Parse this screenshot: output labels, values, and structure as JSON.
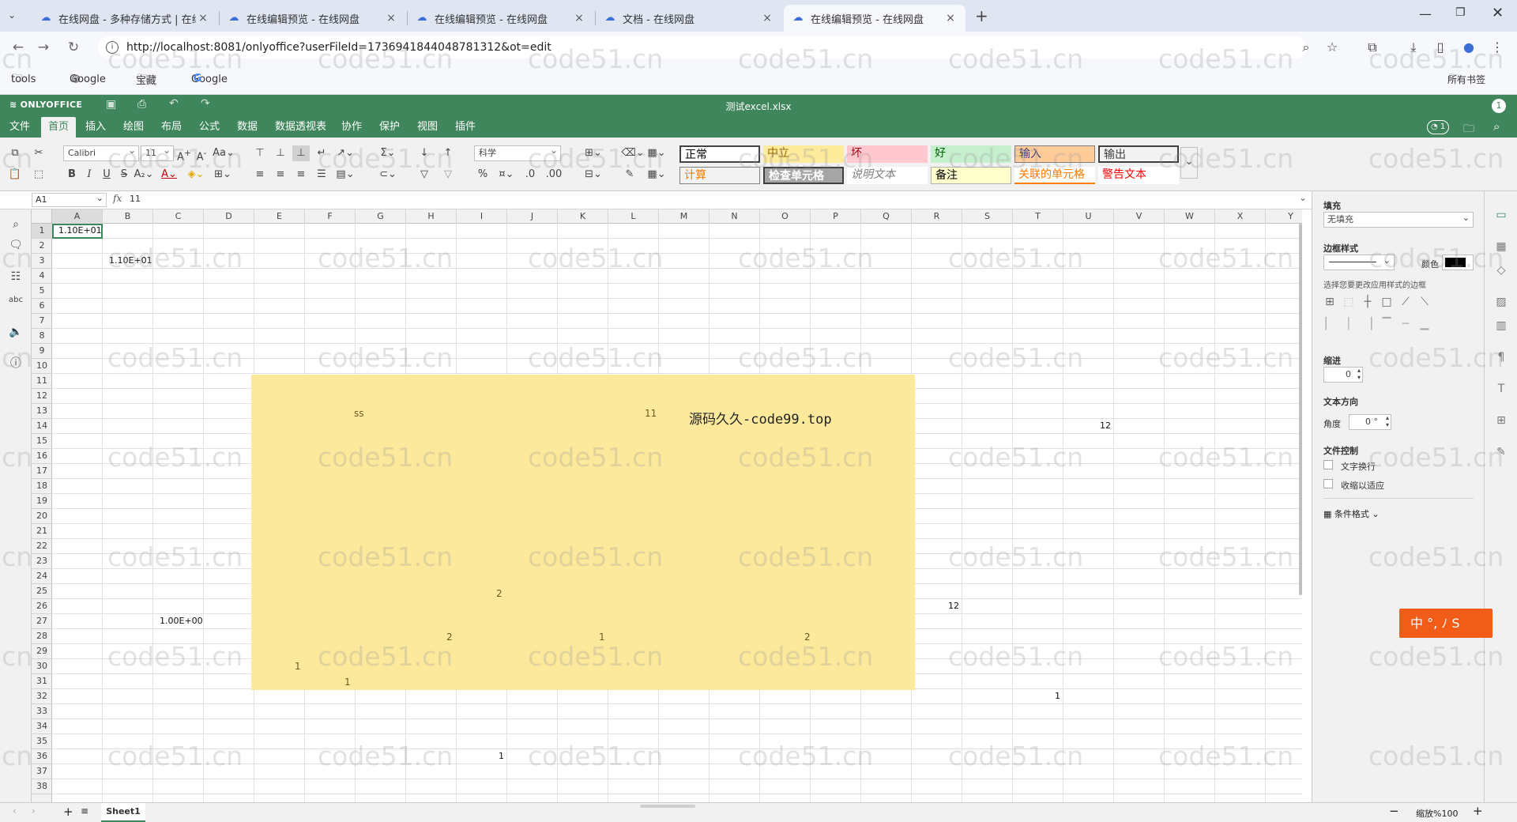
{
  "browser": {
    "tabs": [
      {
        "label": "在线网盘 - 多种存储方式 | 在线",
        "active": false
      },
      {
        "label": "在线编辑预览 - 在线网盘",
        "active": false
      },
      {
        "label": "在线编辑预览 - 在线网盘",
        "active": false
      },
      {
        "label": "文档 - 在线网盘",
        "active": false
      },
      {
        "label": "在线编辑预览 - 在线网盘",
        "active": true
      }
    ],
    "url": "http://localhost:8081/onlyoffice?userFileId=1736941844048781312&ot=edit",
    "bookmarks": [
      "tools",
      "Google",
      "宝藏",
      "Google"
    ],
    "all_bookmarks": "所有书签"
  },
  "editor": {
    "brand": "ONLYOFFICE",
    "filename": "测试excel.xlsx",
    "user_initial": "1",
    "menu": [
      "文件",
      "首页",
      "插入",
      "绘图",
      "布局",
      "公式",
      "数据",
      "数据透视表",
      "协作",
      "保护",
      "视图",
      "插件"
    ],
    "active_menu": "首页",
    "collab_count": "1"
  },
  "toolbar": {
    "font_name": "Calibri",
    "font_size": "11",
    "number_format": "科学",
    "cell_styles": [
      {
        "label": "正常",
        "bg": "#ffffff",
        "color": "#000000"
      },
      {
        "label": "中立",
        "bg": "#ffeb9c",
        "color": "#9c6500"
      },
      {
        "label": "坏",
        "bg": "#ffc7ce",
        "color": "#9c0006"
      },
      {
        "label": "好",
        "bg": "#c6efce",
        "color": "#006100"
      },
      {
        "label": "输入",
        "bg": "#ffcc99",
        "color": "#3f3f76"
      },
      {
        "label": "输出",
        "bg": "#f2f2f2",
        "color": "#3f3f3f"
      },
      {
        "label": "计算",
        "bg": "#f2f2f2",
        "color": "#fa7d00"
      },
      {
        "label": "检查单元格",
        "bg": "#a5a5a5",
        "color": "#ffffff"
      },
      {
        "label": "说明文本",
        "bg": "#ffffff",
        "color": "#7f7f7f"
      },
      {
        "label": "备注",
        "bg": "#ffffcc",
        "color": "#000000"
      },
      {
        "label": "关联的单元格",
        "bg": "#ffffff",
        "color": "#fa7d00"
      },
      {
        "label": "警告文本",
        "bg": "#ffffff",
        "color": "#ff0000"
      }
    ]
  },
  "formula_bar": {
    "cell_ref": "A1",
    "fx": "fx",
    "value": "11"
  },
  "sheet": {
    "columns": [
      "A",
      "B",
      "C",
      "D",
      "E",
      "F",
      "G",
      "H",
      "I",
      "J",
      "K",
      "L",
      "M",
      "N",
      "O",
      "P",
      "Q",
      "R",
      "S",
      "T",
      "U",
      "V",
      "W",
      "X",
      "Y"
    ],
    "rows": [
      "1",
      "2",
      "3",
      "4",
      "5",
      "6",
      "7",
      "8",
      "9",
      "10",
      "11",
      "12",
      "13",
      "14",
      "15",
      "16",
      "17",
      "18",
      "19",
      "20",
      "21",
      "22",
      "23",
      "24",
      "25",
      "26",
      "27",
      "28",
      "29",
      "30",
      "31",
      "32",
      "33",
      "34",
      "35",
      "36",
      "37",
      "38"
    ],
    "cells": [
      {
        "ref": "A1",
        "text": "1.10E+01"
      },
      {
        "ref": "B3",
        "text": "1.10E+01"
      },
      {
        "ref": "C27",
        "text": "1.00E+00"
      },
      {
        "ref": "U14",
        "text": "12"
      },
      {
        "ref": "R26",
        "text": "12"
      },
      {
        "ref": "T32",
        "text": "1"
      },
      {
        "ref": "I36",
        "text": "1"
      }
    ],
    "shape": {
      "title": "源码久久-code99.top",
      "labels": [
        "ss",
        "11",
        "2",
        "2",
        "1",
        "2",
        "1",
        "1"
      ]
    }
  },
  "right_panel": {
    "fill_label": "填充",
    "fill_value": "无填充",
    "border_style_label": "边框样式",
    "color_label": "颜色",
    "border_hint": "选择您要更改应用样式的边框",
    "indent_label": "缩进",
    "indent_value": "0",
    "text_direction_label": "文本方向",
    "angle_label": "角度",
    "angle_value": "0 °",
    "text_control_label": "文件控制",
    "wrap_text": "文字换行",
    "shrink_fit": "收缩以适应",
    "conditional_format": "条件格式"
  },
  "status": {
    "sheet_name": "Sheet1",
    "zoom": "缩放%100"
  },
  "ime": {
    "label": "中 °, ﾉ S"
  },
  "watermark": "code51.cn"
}
